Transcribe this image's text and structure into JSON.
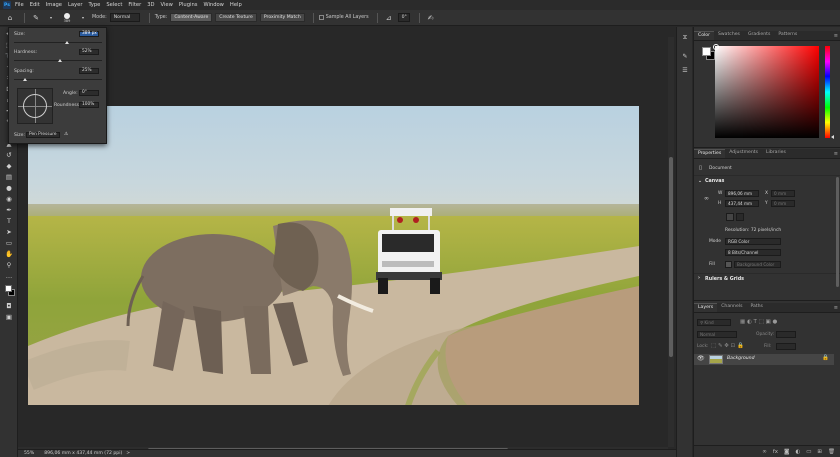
{
  "app": {
    "logo": "Ps"
  },
  "menu": [
    "File",
    "Edit",
    "Image",
    "Layer",
    "Type",
    "Select",
    "Filter",
    "3D",
    "View",
    "Plugins",
    "Window",
    "Help"
  ],
  "options": {
    "brush_size": "389",
    "mode_label": "Mode:",
    "mode_value": "Normal",
    "type_label": "Type:",
    "type_buttons": [
      "Content-Aware",
      "Create Texture",
      "Proximity Match"
    ],
    "sample_all_layers": "Sample All Layers",
    "angle": "0°"
  },
  "brush_popup": {
    "size_label": "Size:",
    "size_value": "389 px",
    "hardness_label": "Hardness:",
    "hardness_value": "52%",
    "spacing_label": "Spacing:",
    "spacing_value": "25%",
    "angle_label": "Angle:",
    "angle_value": "0°",
    "roundness_label": "Roundness:",
    "roundness_value": "100%",
    "size_ctrl_label": "Size:",
    "size_ctrl_value": "Pen Pressure",
    "size_fraction": 0.6,
    "hardness_fraction": 0.52,
    "spacing_fraction": 0.12
  },
  "status": {
    "zoom": "55%",
    "doc_size": "896,06 mm x 437,44 mm (72 ppi)",
    "arrow": ">"
  },
  "color_panel": {
    "tabs": [
      "Color",
      "Swatches",
      "Gradients",
      "Patterns"
    ],
    "fg": "#ffffff",
    "bg": "#000000",
    "hue": "#ff0000"
  },
  "properties": {
    "tabs": [
      "Properties",
      "Adjustments",
      "Libraries"
    ],
    "document_label": "Document",
    "canvas_head": "Canvas",
    "w_label": "W",
    "w_value": "896,06 mm",
    "h_label": "H",
    "h_value": "437,44 mm",
    "x_label": "X",
    "x_value": "0 mm",
    "y_label": "Y",
    "y_value": "0 mm",
    "resolution": "Resolution: 72 pixels/inch",
    "mode_label": "Mode",
    "mode_value": "RGB Color",
    "bits_value": "8 Bits/Channel",
    "fill_label": "Fill",
    "fill_value": "Background Color",
    "rulers_head": "Rulers & Grids"
  },
  "layers": {
    "tabs": [
      "Layers",
      "Channels",
      "Paths"
    ],
    "kind_label": "Kind",
    "blend_value": "Normal",
    "opacity_label": "Opacity:",
    "lock_label": "Lock:",
    "fill_label": "Fill:",
    "layer_name": "Background"
  }
}
